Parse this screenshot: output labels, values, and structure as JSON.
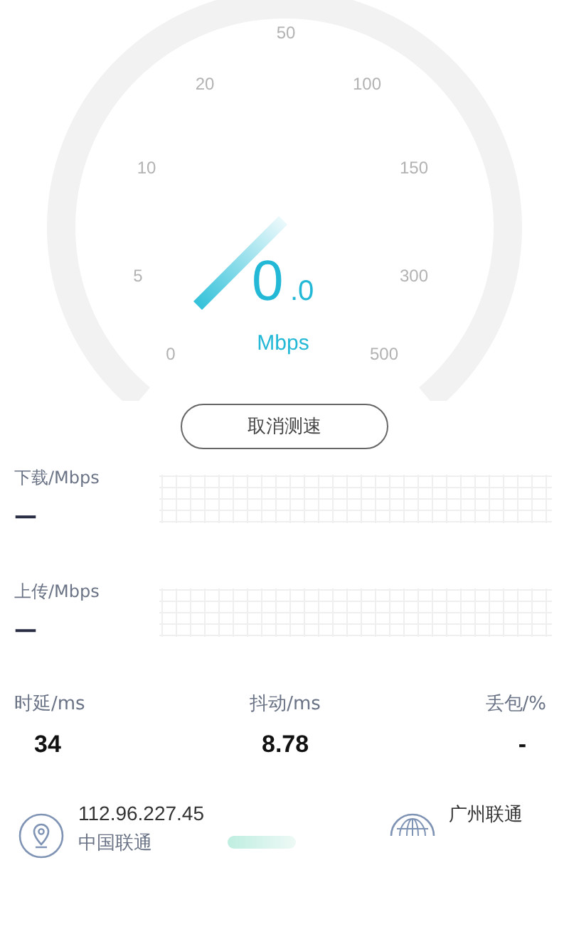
{
  "gauge": {
    "ticks": [
      "0",
      "5",
      "10",
      "20",
      "50",
      "100",
      "150",
      "300",
      "500"
    ],
    "value_int": "0",
    "value_frac": ".0",
    "unit": "Mbps"
  },
  "cancel_button": "取消测速",
  "graphs": [
    {
      "label": "下载/Mbps",
      "value": "—"
    },
    {
      "label": "上传/Mbps",
      "value": "—"
    }
  ],
  "stats": [
    {
      "label": "时延/ms",
      "value": "34"
    },
    {
      "label": "抖动/ms",
      "value": "8.78"
    },
    {
      "label": "丢包/%",
      "value": "-"
    }
  ],
  "client": {
    "ip": "112.96.227.45",
    "isp": "中国联通"
  },
  "server": {
    "name": "广州联通"
  }
}
